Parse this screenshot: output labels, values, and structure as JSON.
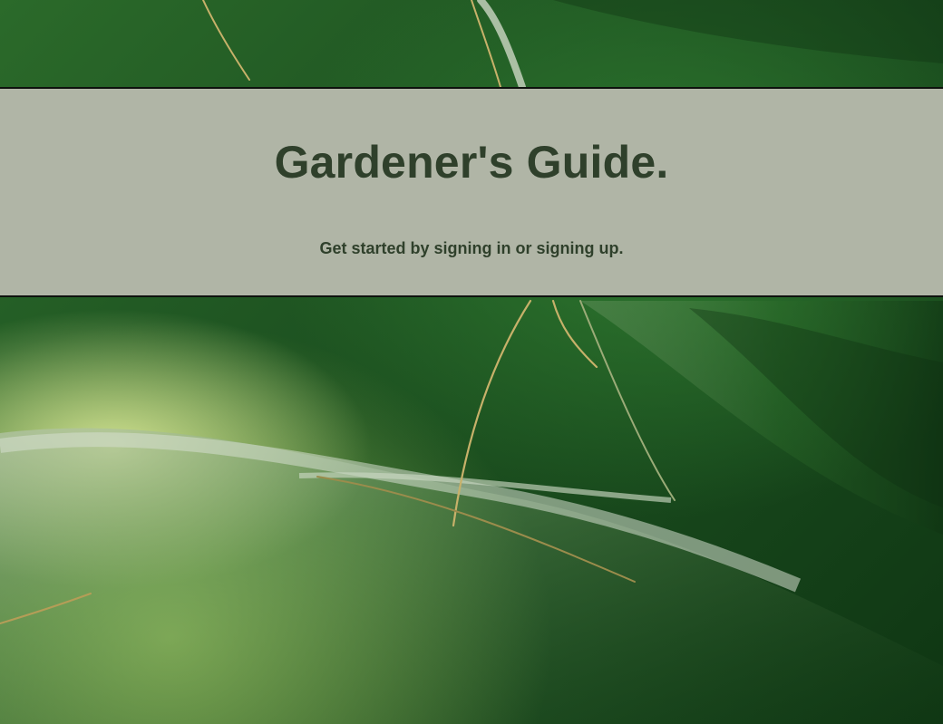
{
  "hero": {
    "title": "Gardener's Guide.",
    "subtitle": "Get started by signing in or signing up."
  },
  "colors": {
    "band_background": "#b0b5a6",
    "text_dark_green": "#2f402b",
    "border": "#0e120e"
  }
}
